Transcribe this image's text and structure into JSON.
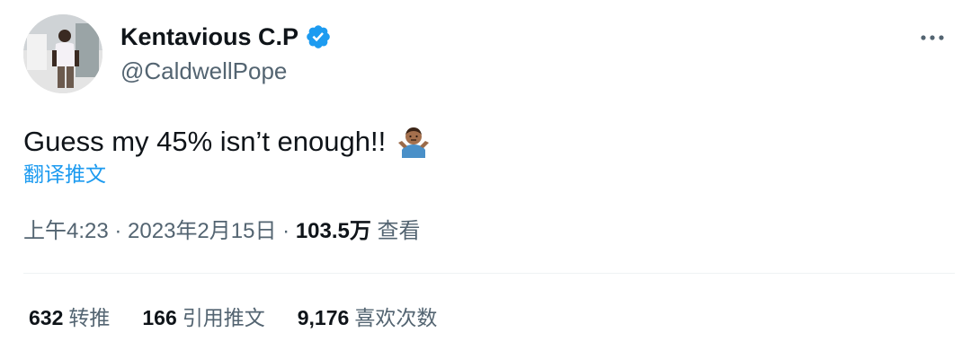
{
  "tweet": {
    "author_name": "Kentavious C.P",
    "handle": "@CaldwellPope",
    "text": "Guess my 45% isn’t enough!!",
    "translate_label": "翻译推文",
    "time": "上午4:23",
    "sep1": " · ",
    "date": "2023年2月15日",
    "sep2": " · ",
    "views_count": "103.5万",
    "views_label": "查看"
  },
  "stats": [
    {
      "count": "632",
      "label": "转推"
    },
    {
      "count": "166",
      "label": "引用推文"
    },
    {
      "count": "9,176",
      "label": "喜欢次数"
    }
  ],
  "colors": {
    "accent": "#1d9bf0",
    "secondary_text": "#536471",
    "primary_text": "#0f1419"
  },
  "icons": {
    "verified": "verified-badge-icon",
    "more": "more-horizontal-icon",
    "emoji": "person-shrugging-emoji"
  }
}
